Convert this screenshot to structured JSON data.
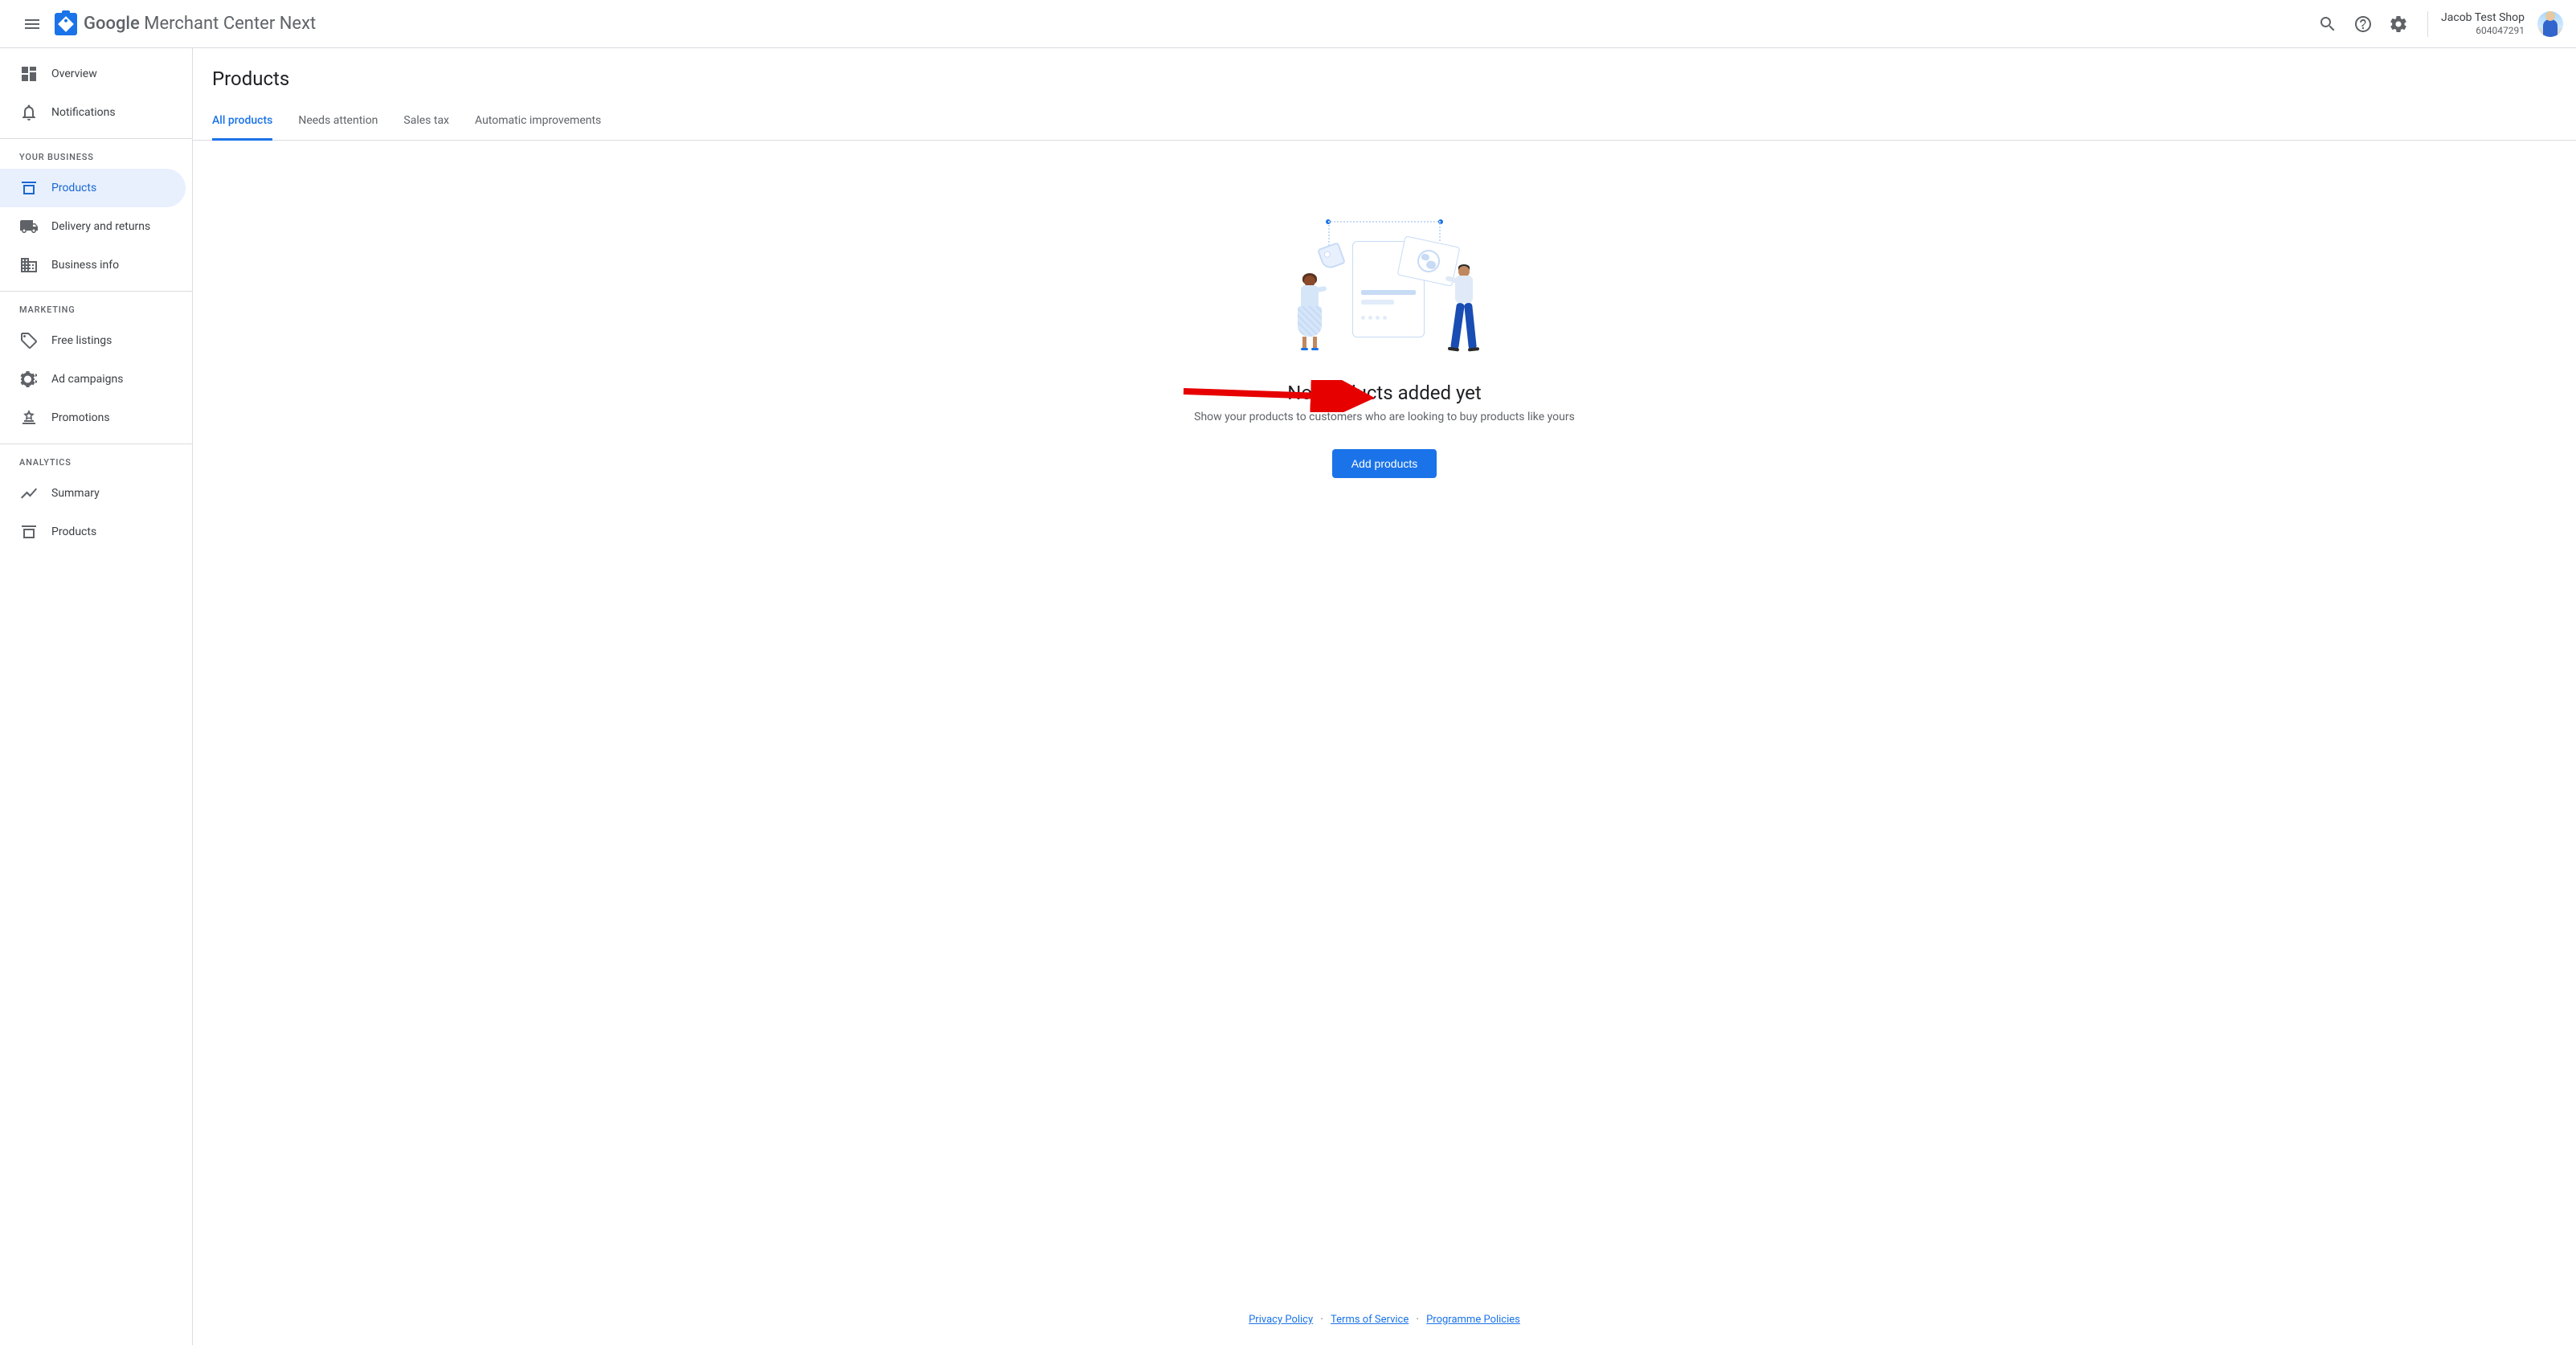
{
  "header": {
    "app_title_strong": "Google",
    "app_title_rest": "Merchant Center Next",
    "account_name": "Jacob Test Shop",
    "account_id": "604047291"
  },
  "sidebar": {
    "items": [
      {
        "label": "Overview",
        "icon": "overview"
      },
      {
        "label": "Notifications",
        "icon": "bell"
      }
    ],
    "sections": [
      {
        "title": "YOUR BUSINESS",
        "items": [
          {
            "label": "Products",
            "icon": "products",
            "active": true
          },
          {
            "label": "Delivery and returns",
            "icon": "truck"
          },
          {
            "label": "Business info",
            "icon": "building"
          }
        ]
      },
      {
        "title": "MARKETING",
        "items": [
          {
            "label": "Free listings",
            "icon": "tag"
          },
          {
            "label": "Ad campaigns",
            "icon": "megaphone"
          },
          {
            "label": "Promotions",
            "icon": "promo"
          }
        ]
      },
      {
        "title": "ANALYTICS",
        "items": [
          {
            "label": "Summary",
            "icon": "trending"
          },
          {
            "label": "Products",
            "icon": "products"
          }
        ]
      }
    ]
  },
  "page": {
    "title": "Products",
    "tabs": [
      {
        "label": "All products",
        "active": true
      },
      {
        "label": "Needs attention"
      },
      {
        "label": "Sales tax"
      },
      {
        "label": "Automatic improvements"
      }
    ]
  },
  "empty": {
    "title": "No products added yet",
    "description": "Show your products to customers who are looking to buy products like yours",
    "button": "Add products"
  },
  "footer": {
    "privacy": "Privacy Policy",
    "terms": "Terms of Service",
    "programme": "Programme Policies"
  }
}
